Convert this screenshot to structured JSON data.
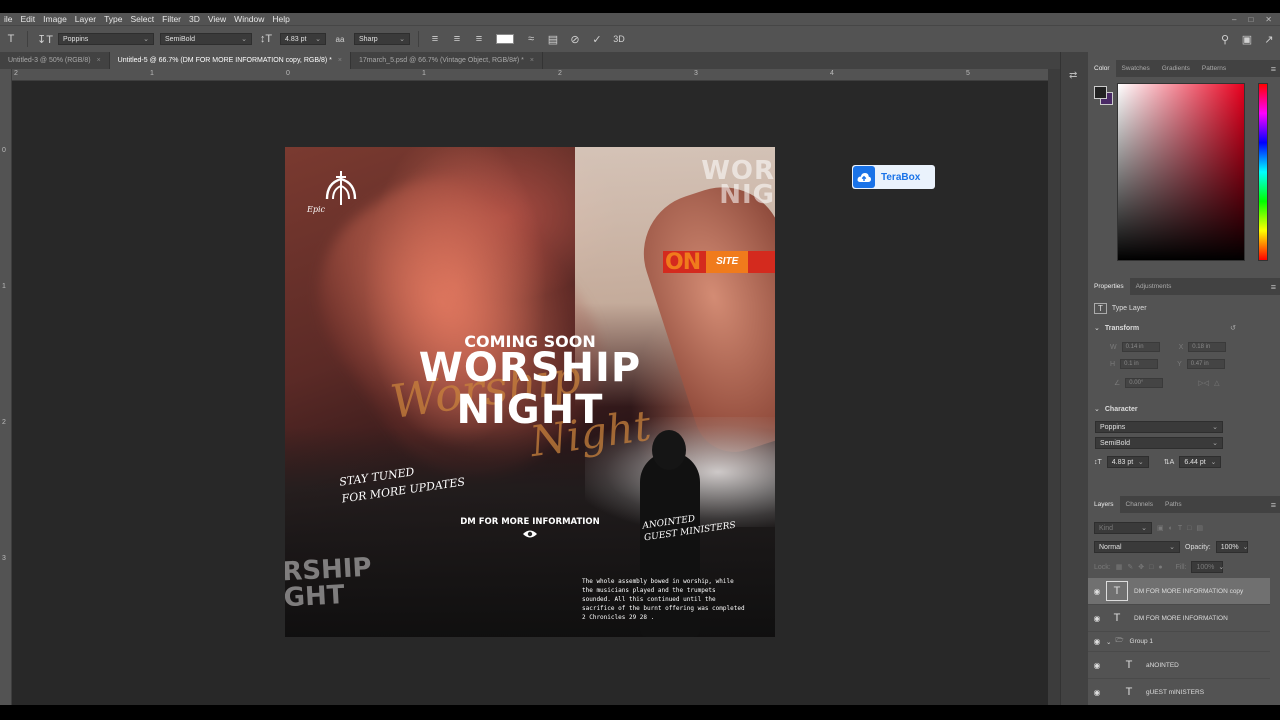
{
  "menu": [
    "ile",
    "Edit",
    "Image",
    "Layer",
    "Type",
    "Select",
    "Filter",
    "3D",
    "View",
    "Window",
    "Help"
  ],
  "options": {
    "font_family": "Poppins",
    "font_style": "SemiBold",
    "font_size": "4.83 pt",
    "aa_label": "aa",
    "antialias": "Sharp"
  },
  "tabs": [
    {
      "label": "Untitled-3 @ 50% (RGB/8)",
      "close": "×",
      "active": false
    },
    {
      "label": "Untitled-5 @ 66.7% (DM FOR MORE INFORMATION copy, RGB/8) *",
      "close": "×",
      "active": true
    },
    {
      "label": "17march_5.psd @ 66.7% (Vintage Object, RGB/8#) *",
      "close": "×",
      "active": false
    }
  ],
  "ruler_h": [
    "2",
    "1",
    "0",
    "1",
    "2",
    "3",
    "4",
    "5"
  ],
  "ruler_v": [
    "0",
    "1",
    "2",
    "3"
  ],
  "poster": {
    "logo_text": "Epic",
    "wor_line1": "WOR",
    "wor_line2": "NIG",
    "on": "ON",
    "site": "SITE",
    "coming": "COMING SOON",
    "title1": "WORSHIP",
    "title2": "NIGHT",
    "script1": "Worship",
    "script2": "Night",
    "stay1": "STAY TUNED",
    "stay2": "FOR MORE UPDATES",
    "dm": "DM FOR MORE INFORMATION",
    "anointed1": "ANOINTED",
    "anointed2": "GUEST MINISTERS",
    "verse": "The whole assembly bowed in worship, while the musicians played and the trumpets sounded. All this continued until the sacrifice of the burnt offering was completed   2 Chronicles 29 28 .",
    "ship1": "RSHIP",
    "ship2": "GHT"
  },
  "terabox": "TeraBox",
  "color_tabs": [
    "Color",
    "Swatches",
    "Gradients",
    "Patterns"
  ],
  "props_tabs": [
    "Properties",
    "Adjustments"
  ],
  "props": {
    "type_layer": "Type Layer",
    "transform": "Transform",
    "w": "W",
    "h": "H",
    "x": "X",
    "y": "Y",
    "w_val": "0.14 in",
    "h_val": "0.1 in",
    "x_val": "0.18 in",
    "y_val": "0.47 in",
    "angle_val": "0.00°",
    "character": "Character",
    "font": "Poppins",
    "style": "SemiBold",
    "size": "4.83 pt",
    "leading": "6.44 pt"
  },
  "layers_tabs": [
    "Layers",
    "Channels",
    "Paths"
  ],
  "layers_ctrl": {
    "kind": "Kind",
    "blend": "Normal",
    "opacity_label": "Opacity:",
    "opacity": "100%",
    "lock_label": "Lock:",
    "fill_label": "Fill:",
    "fill": "100%"
  },
  "layers": [
    {
      "name": "DM FOR MORE INFORMATION copy",
      "kind": "text",
      "selected": true
    },
    {
      "name": "DM FOR MORE INFORMATION",
      "kind": "text",
      "selected": false
    },
    {
      "name": "Group 1",
      "kind": "group",
      "selected": false
    },
    {
      "name": "aNOINTED",
      "kind": "text",
      "selected": false
    },
    {
      "name": "gUEST mINISTERS",
      "kind": "text",
      "selected": false
    }
  ],
  "colors": {
    "ui_bg": "#535353",
    "canvas": "#282828",
    "accent_red": "#d42a1e",
    "accent_orange": "#f07b1c",
    "terabox_blue": "#1a73e8"
  }
}
